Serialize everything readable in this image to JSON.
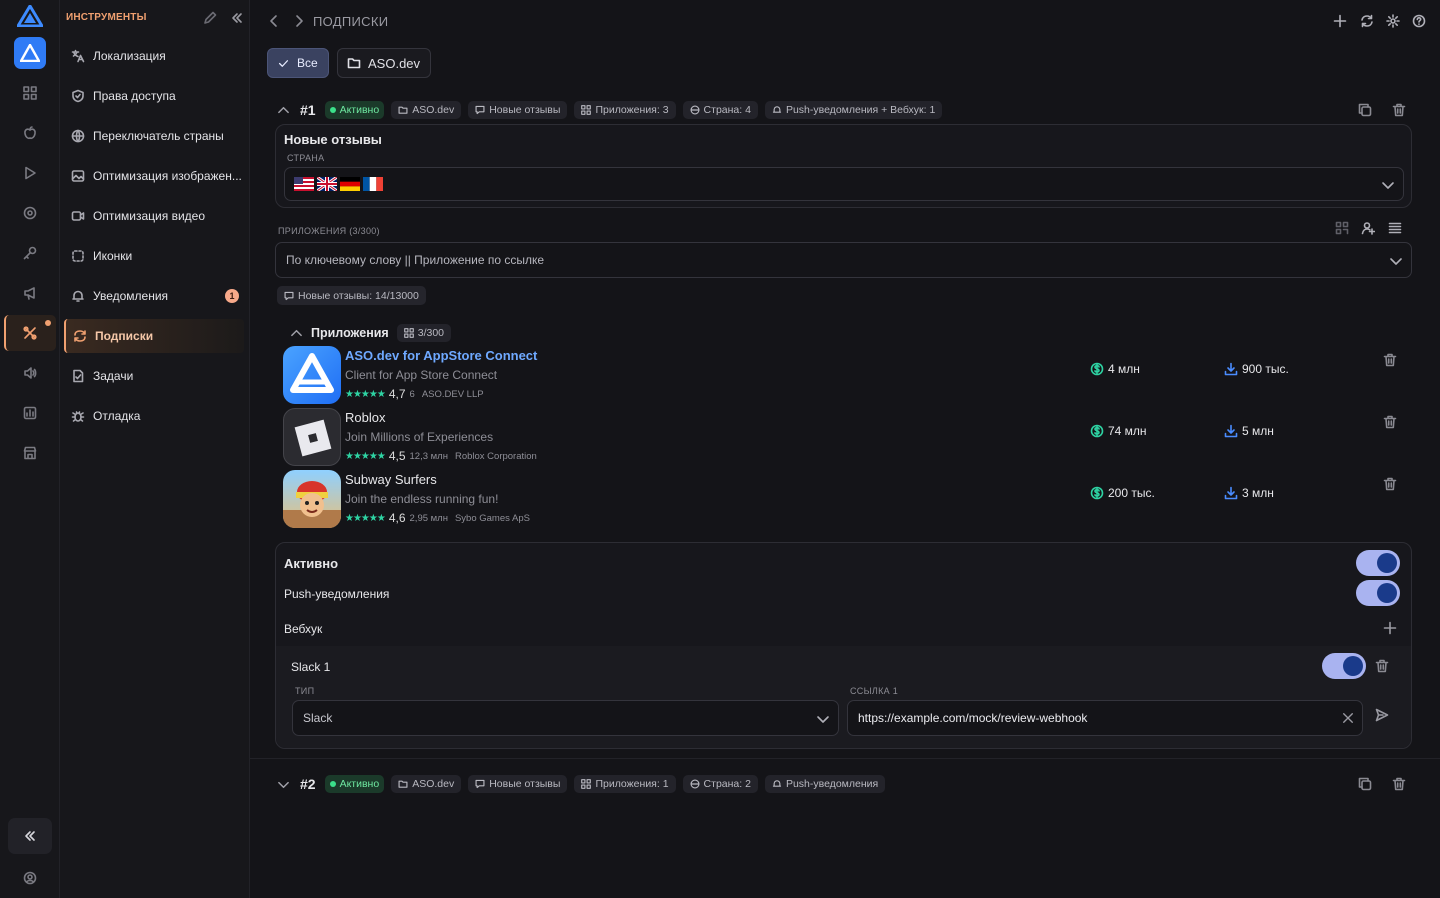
{
  "sidebar": {
    "section_title": "ИНСТРУМЕНТЫ",
    "items": [
      {
        "label": "Локализация",
        "icon": "translate-icon"
      },
      {
        "label": "Права доступа",
        "icon": "shield-icon"
      },
      {
        "label": "Переключатель страны",
        "icon": "globe-icon"
      },
      {
        "label": "Оптимизация изображен...",
        "icon": "image-icon"
      },
      {
        "label": "Оптимизация видео",
        "icon": "video-icon"
      },
      {
        "label": "Иконки",
        "icon": "icons-icon"
      },
      {
        "label": "Уведомления",
        "icon": "bell-icon",
        "badge": "1"
      },
      {
        "label": "Подписки",
        "icon": "subscriptions-icon",
        "active": true
      },
      {
        "label": "Задачи",
        "icon": "tasks-icon"
      },
      {
        "label": "Отладка",
        "icon": "bug-icon"
      }
    ]
  },
  "header": {
    "title": "ПОДПИСКИ"
  },
  "filters": {
    "all_label": "Все",
    "aso_label": "ASO.dev"
  },
  "sub1": {
    "number": "#1",
    "status": "Активно",
    "tags": [
      "ASO.dev",
      "Новые отзывы",
      "Приложения: 3",
      "Страна: 4",
      "Push-уведомления + Вебхук: 1"
    ],
    "event_title": "Новые отзывы",
    "country_label": "СТРАНА",
    "apps_label": "ПРИЛОЖЕНИЯ (3/300)",
    "apps_placeholder": "По ключевому слову || Приложение по ссылке",
    "quota": "Новые отзывы: 14/13000",
    "apps_section": "Приложения",
    "apps_count": "3/300",
    "apps": [
      {
        "name": "ASO.dev for AppStore Connect",
        "subtitle": "Client for App Store Connect",
        "rating": "4,7",
        "ratings_count": "6",
        "developer": "ASO.DEV LLP",
        "revenue": "4 млн",
        "downloads": "900 тыс."
      },
      {
        "name": "Roblox",
        "subtitle": "Join Millions of Experiences",
        "rating": "4,5",
        "ratings_count": "12,3 млн",
        "developer": "Roblox Corporation",
        "revenue": "74 млн",
        "downloads": "5 млн"
      },
      {
        "name": "Subway Surfers",
        "subtitle": "Join the endless running fun!",
        "rating": "4,6",
        "ratings_count": "2,95 млн",
        "developer": "Sybo Games ApS",
        "revenue": "200 тыс.",
        "downloads": "3 млн"
      }
    ],
    "active_label": "Активно",
    "push_label": "Push-уведомления",
    "webhook_label": "Вебхук",
    "webhook": {
      "name": "Slack 1",
      "type_label": "ТИП",
      "type_value": "Slack",
      "link_label": "ССЫЛКА 1",
      "link_value": "https://example.com/mock/review-webhook"
    }
  },
  "sub2": {
    "number": "#2",
    "status": "Активно",
    "tags": [
      "ASO.dev",
      "Новые отзывы",
      "Приложения: 1",
      "Страна: 2",
      "Push-уведомления"
    ]
  },
  "colors": {
    "accent": "#f0a070",
    "green": "#2ed3a3",
    "toggle": "#a9b3f0",
    "bg": "#141418"
  }
}
